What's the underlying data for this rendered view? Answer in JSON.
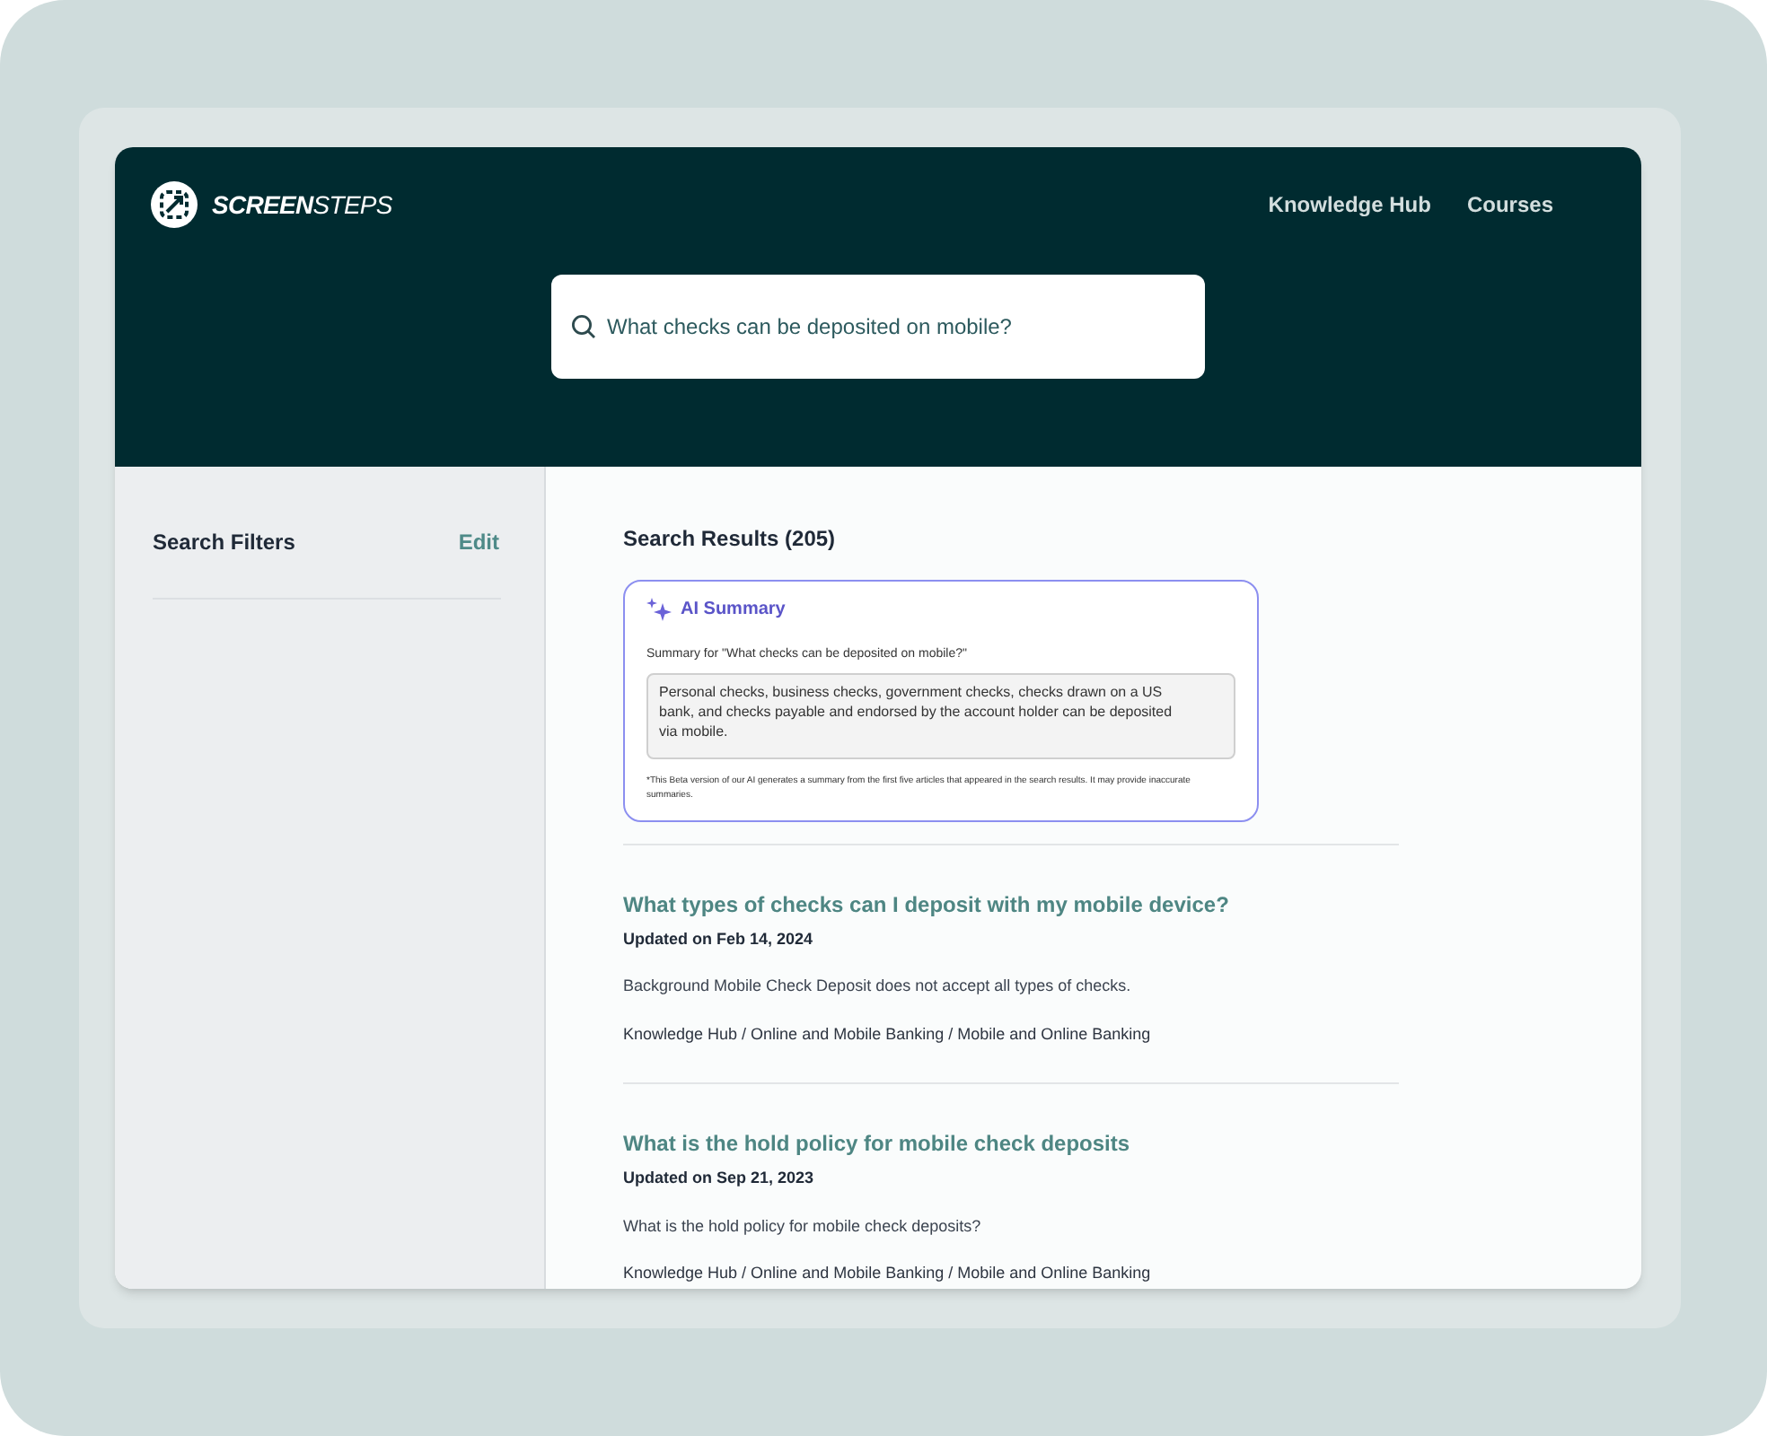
{
  "header": {
    "logo": "**SCREEN**STEPS",
    "nav": [
      "Knowledge Hub",
      "Courses"
    ],
    "search": {
      "value": "What checks can be deposited on mobile?"
    }
  },
  "sidebar": {
    "title": "Search Filters",
    "edit": "Edit"
  },
  "results": {
    "heading": "Search Results (205)",
    "ai_summary": {
      "title": "AI Summary",
      "query": "Summary for \"What checks can be deposited on mobile?\"",
      "answer": "Personal checks, business checks, government checks, checks drawn on a US bank, and checks payable and endorsed by the account holder can be deposited via mobile.",
      "disclaimer": "*This Beta version of our AI generates a summary from the first five articles that appeared in the search results. It may provide inaccurate summaries."
    },
    "items": [
      {
        "title": "What types of checks can I deposit with my mobile device?",
        "updated": "Updated on Feb 14, 2024",
        "excerpt": "Background Mobile Check Deposit does not accept all types of checks.",
        "path": "Knowledge Hub / Online and Mobile Banking / Mobile and Online Banking"
      },
      {
        "title": "What is the hold policy for mobile check deposits",
        "updated": "Updated on Sep 21, 2023",
        "excerpt": "What is the hold policy for mobile check deposits?",
        "path": "Knowledge Hub / Online and Mobile Banking / Mobile and Online Banking"
      }
    ]
  }
}
